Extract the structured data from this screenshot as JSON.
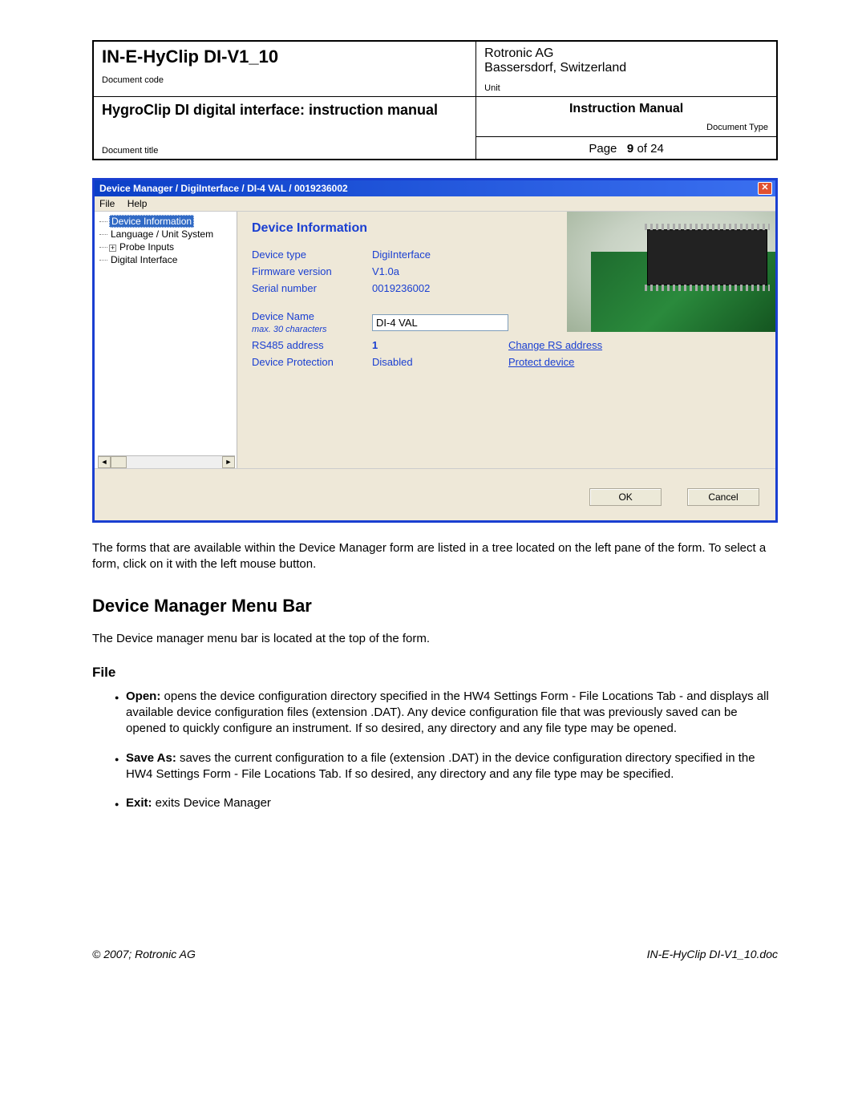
{
  "header": {
    "doc_code": "IN-E-HyClip DI-V1_10",
    "doc_code_label": "Document code",
    "company_line1": "Rotronic AG",
    "company_line2": "Bassersdorf, Switzerland",
    "unit_label": "Unit",
    "doc_title": "HygroClip DI digital interface: instruction manual",
    "doc_title_label": "Document title",
    "manual_label": "Instruction Manual",
    "doctype_label": "Document Type",
    "page_prefix": "Page",
    "page_current": "9",
    "page_of": "of 24"
  },
  "window": {
    "title": "Device Manager / DigiInterface / DI-4 VAL / 0019236002",
    "menu": {
      "file": "File",
      "help": "Help"
    },
    "tree": {
      "items": [
        {
          "label": "Device Information",
          "selected": true,
          "expandable": false
        },
        {
          "label": "Language / Unit System",
          "selected": false,
          "expandable": false
        },
        {
          "label": "Probe Inputs",
          "selected": false,
          "expandable": true
        },
        {
          "label": "Digital Interface",
          "selected": false,
          "expandable": false
        }
      ]
    },
    "panel": {
      "heading": "Device Information",
      "rows": {
        "device_type": {
          "label": "Device type",
          "value": "DigiInterface"
        },
        "firmware": {
          "label": "Firmware version",
          "value": "V1.0a"
        },
        "serial": {
          "label": "Serial number",
          "value": "0019236002"
        },
        "name": {
          "label": "Device Name",
          "sublabel": "max. 30 characters",
          "value": "DI-4 VAL"
        },
        "rs485": {
          "label": "RS485 address",
          "value": "1",
          "link": "Change RS address"
        },
        "protection": {
          "label": "Device Protection",
          "value": "Disabled",
          "link": "Protect device"
        }
      }
    },
    "buttons": {
      "ok": "OK",
      "cancel": "Cancel"
    }
  },
  "body": {
    "p1": "The forms that are available within the Device Manager form are listed in a tree located on the left pane of the form. To select a form, click on it with the left mouse button.",
    "h2": "Device Manager Menu Bar",
    "p2": "The Device manager menu bar is located at the top of the form.",
    "h3": "File",
    "bullets": [
      {
        "strong": "Open:",
        "text": " opens the device configuration directory specified in the HW4 Settings Form - File Locations Tab - and displays all available device configuration files (extension .DAT). Any device configuration file that was previously saved can be opened to quickly configure an instrument. If so desired, any directory and any file type may be opened."
      },
      {
        "strong": "Save As:",
        "text": " saves the current configuration to a file (extension .DAT) in the device configuration directory specified in the HW4 Settings Form - File Locations Tab. If so desired, any directory and any file type may be specified."
      },
      {
        "strong": "Exit:",
        "text": " exits Device Manager"
      }
    ]
  },
  "footer": {
    "left": "© 2007; Rotronic AG",
    "right": "IN-E-HyClip DI-V1_10.doc"
  }
}
